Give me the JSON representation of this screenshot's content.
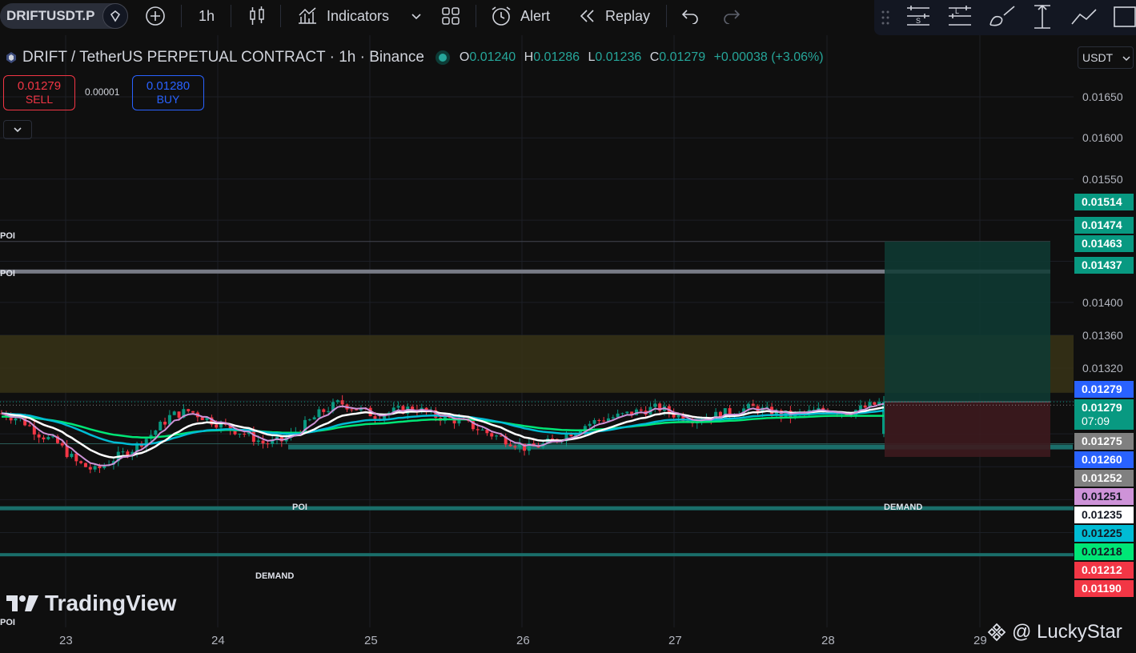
{
  "toolbar": {
    "symbol": "DRIFTUSDT.P",
    "interval": "1h",
    "indicators_label": "Indicators",
    "alert_label": "Alert",
    "replay_label": "Replay"
  },
  "legend": {
    "title": "DRIFT / TetherUS PERPETUAL CONTRACT · 1h · Binance",
    "o_label": "O",
    "o_value": "0.01240",
    "h_label": "H",
    "h_value": "0.01286",
    "l_label": "L",
    "l_value": "0.01236",
    "c_label": "C",
    "c_value": "0.01279",
    "change": "+0.00038 (+3.06%)"
  },
  "trade": {
    "sell_price": "0.01279",
    "sell_label": "SELL",
    "spread": "0.00001",
    "buy_price": "0.01280",
    "buy_label": "BUY"
  },
  "price_scale": {
    "currency": "USDT",
    "ticks": [
      "0.01650",
      "0.01600",
      "0.01550",
      "0.01400",
      "0.01360",
      "0.01320"
    ],
    "tags": [
      {
        "value": "0.01514",
        "bg": "#089981",
        "fg": "#ffffff"
      },
      {
        "value": "0.01474",
        "bg": "#089981",
        "fg": "#ffffff"
      },
      {
        "value": "0.01463",
        "bg": "#089981",
        "fg": "#ffffff"
      },
      {
        "value": "0.01437",
        "bg": "#089981",
        "fg": "#ffffff"
      },
      {
        "value": "0.01279",
        "bg": "#2962ff",
        "fg": "#ffffff"
      },
      {
        "value": "0.01279",
        "bg": "#089981",
        "fg": "#ffffff",
        "sub": "07:09"
      },
      {
        "value": "0.01275",
        "bg": "#808080",
        "fg": "#ffffff"
      },
      {
        "value": "0.01260",
        "bg": "#2962ff",
        "fg": "#ffffff"
      },
      {
        "value": "0.01252",
        "bg": "#808080",
        "fg": "#ffffff"
      },
      {
        "value": "0.01251",
        "bg": "#ce93d8",
        "fg": "#131722"
      },
      {
        "value": "0.01235",
        "bg": "#ffffff",
        "fg": "#131722"
      },
      {
        "value": "0.01225",
        "bg": "#00bcd4",
        "fg": "#131722"
      },
      {
        "value": "0.01218",
        "bg": "#00e676",
        "fg": "#131722"
      },
      {
        "value": "0.01212",
        "bg": "#f23645",
        "fg": "#ffffff"
      },
      {
        "value": "0.01190",
        "bg": "#f23645",
        "fg": "#ffffff"
      }
    ]
  },
  "time_axis": [
    "23",
    "24",
    "25",
    "26",
    "27",
    "28",
    "29"
  ],
  "zones": {
    "poi_1": "POI",
    "poi_2": "POI",
    "poi_3": "POI",
    "poi_4": "POI",
    "demand_1": "DEMAND",
    "demand_2": "DEMAND"
  },
  "brand": "TradingView",
  "watermark": "@ LuckyStar",
  "colors": {
    "up": "#089981",
    "down": "#f23645",
    "ma_white": "#ffffff",
    "ma_pink": "#ce93d8",
    "ma_cyan": "#00bcd4",
    "ma_green": "#00e676",
    "zone_teal": "#1a6e6a",
    "supply": "#3a3416"
  },
  "chart_data": {
    "type": "candlestick",
    "title": "DRIFT / TetherUS PERPETUAL CONTRACT · 1h · Binance",
    "xlabel": "",
    "ylabel": "",
    "x_categories": [
      "23",
      "24",
      "25",
      "26",
      "27",
      "28",
      "29"
    ],
    "ylim": [
      0.0109,
      0.017
    ],
    "close_path": [
      0.01265,
      0.01258,
      0.0124,
      0.01228,
      0.01205,
      0.01195,
      0.0121,
      0.01222,
      0.0124,
      0.01262,
      0.01268,
      0.01258,
      0.01248,
      0.0124,
      0.01228,
      0.01232,
      0.01248,
      0.01266,
      0.01278,
      0.0127,
      0.01262,
      0.01268,
      0.01272,
      0.01262,
      0.01258,
      0.0125,
      0.0124,
      0.01232,
      0.01222,
      0.01228,
      0.01238,
      0.0125,
      0.01258,
      0.01262,
      0.01268,
      0.01272,
      0.01262,
      0.01258,
      0.01262,
      0.01268,
      0.01272,
      0.01266,
      0.01262,
      0.01266,
      0.0127,
      0.01266,
      0.01272,
      0.01279
    ],
    "last": {
      "open": 0.0124,
      "high": 0.01286,
      "low": 0.01236,
      "close": 0.01279
    },
    "moving_averages": [
      {
        "color": "#ffffff",
        "last": 0.0126
      },
      {
        "color": "#ce93d8",
        "last": 0.01251
      },
      {
        "color": "#00bcd4",
        "last": 0.0126
      },
      {
        "color": "#00e676",
        "last": 0.01252
      }
    ],
    "position": {
      "entry": 0.01279,
      "target": 0.01474,
      "stop": 0.01212
    },
    "levels": [
      {
        "label": "POI",
        "value": 0.01474
      },
      {
        "label": "POI",
        "value": 0.01437
      },
      {
        "label": "POI",
        "value": 0.01225
      },
      {
        "label": "DEMAND",
        "value": 0.01218
      },
      {
        "label": "DEMAND",
        "value": 0.0115
      },
      {
        "label": "POI",
        "value": 0.01093
      }
    ],
    "supply_zone": [
      0.0129,
      0.0136
    ]
  }
}
